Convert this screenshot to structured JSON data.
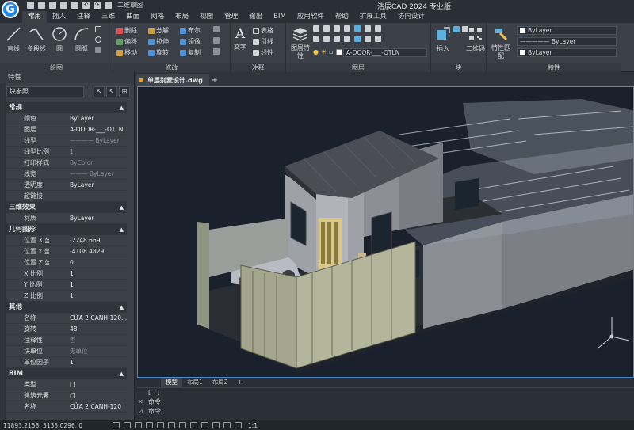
{
  "app": {
    "logo": "G",
    "title": "浩辰CAD 2024 专业版",
    "view_name": "二维草图"
  },
  "menu_tabs": [
    "常用",
    "插入",
    "注释",
    "三维",
    "曲面",
    "网格",
    "布局",
    "视图",
    "管理",
    "输出",
    "BIM",
    "应用软件",
    "帮助",
    "扩展工具",
    "协同设计"
  ],
  "ribbon": {
    "draw": {
      "label": "绘图",
      "tools": [
        "直线",
        "多段线",
        "圆",
        "圆弧"
      ]
    },
    "modify": {
      "label": "修改",
      "tools": [
        "删除",
        "分解",
        "布尔",
        "偏移",
        "拉伸",
        "镜像",
        "移动",
        "旋转",
        "复制"
      ]
    },
    "annotation": {
      "label": "注释",
      "tools": [
        "文字",
        "表格",
        "引线",
        "线性"
      ]
    },
    "layer": {
      "label": "图层",
      "tools": [
        "图层特性"
      ],
      "current_layer": "A-DOOR-___-OTLN"
    },
    "block": {
      "label": "块",
      "tools": [
        "插入",
        "二维码"
      ]
    },
    "properties": {
      "label": "特性",
      "tools": [
        "特性匹配"
      ],
      "color": "ByLayer",
      "linetype": "ByLayer",
      "lineweight": "ByLayer"
    }
  },
  "properties_palette": {
    "title": "特性",
    "selection": "块参照",
    "sections": [
      {
        "name": "常规",
        "rows": [
          {
            "k": "颜色",
            "v": "ByLayer"
          },
          {
            "k": "图层",
            "v": "A-DOOR-___-OTLN"
          },
          {
            "k": "线型",
            "v": "———— ByLayer"
          },
          {
            "k": "线型比例",
            "v": "1"
          },
          {
            "k": "打印样式",
            "v": "ByColor"
          },
          {
            "k": "线宽",
            "v": "——— ByLayer"
          },
          {
            "k": "透明度",
            "v": "ByLayer"
          },
          {
            "k": "超链接",
            "v": ""
          }
        ]
      },
      {
        "name": "三维效果",
        "rows": [
          {
            "k": "材质",
            "v": "ByLayer"
          }
        ]
      },
      {
        "name": "几何图形",
        "rows": [
          {
            "k": "位置 X 坐标",
            "v": "-2248.669"
          },
          {
            "k": "位置 Y 坐标",
            "v": "-4108.4829"
          },
          {
            "k": "位置 Z 坐标",
            "v": "0"
          },
          {
            "k": "X 比例",
            "v": "1"
          },
          {
            "k": "Y 比例",
            "v": "1"
          },
          {
            "k": "Z 比例",
            "v": "1"
          }
        ]
      },
      {
        "name": "其他",
        "rows": [
          {
            "k": "名称",
            "v": "CỬA 2 CÁNH-120..."
          },
          {
            "k": "旋转",
            "v": "48"
          },
          {
            "k": "注释性",
            "v": "否"
          },
          {
            "k": "块单位",
            "v": "无单位"
          },
          {
            "k": "单位因子",
            "v": "1"
          }
        ]
      },
      {
        "name": "BIM",
        "rows": [
          {
            "k": "类型",
            "v": "门"
          },
          {
            "k": "建筑元素类型",
            "v": "门"
          },
          {
            "k": "名称",
            "v": "CỬA 2 CÁNH-120"
          }
        ]
      }
    ]
  },
  "document": {
    "tab_title": "单层别墅设计.dwg",
    "new_tab": "+"
  },
  "layout_tabs": [
    "模型",
    "布局1",
    "布局2",
    "+"
  ],
  "command": {
    "history": "[…]",
    "prompt1": "命令:",
    "prompt2": "命令:"
  },
  "status": {
    "coords": "11893.2158, 5135.0296, 0",
    "scale": "1:1"
  }
}
